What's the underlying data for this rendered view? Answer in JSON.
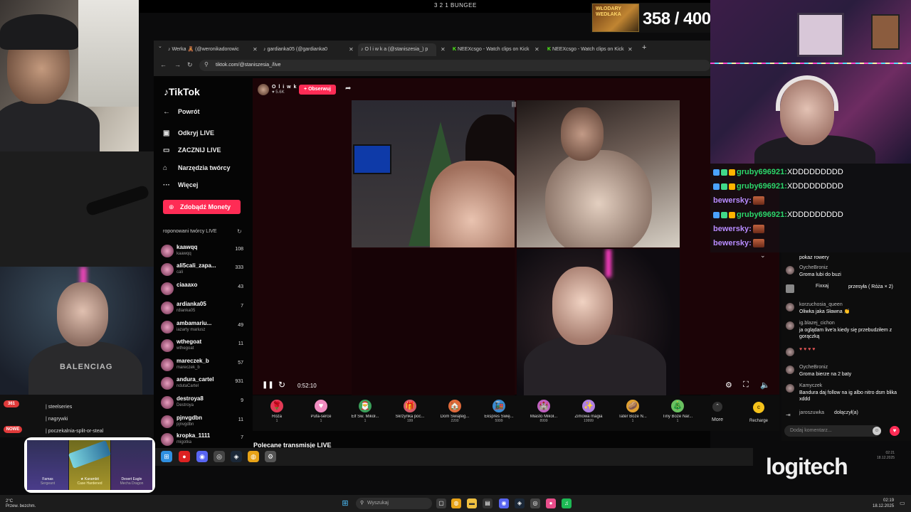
{
  "top_banner": {
    "title": "3 2 1 BUNGEE",
    "counter": "358 / 400",
    "counter_image_text": "WŁODARY WEDŁAKA"
  },
  "browser": {
    "tabs": [
      {
        "label": "Werka 🧸 (@weronikadorowic",
        "active": false
      },
      {
        "label": "gardianka05 (@gardianka0",
        "active": false
      },
      {
        "label": "O l i w k a (@staniszesia_) p",
        "active": true
      },
      {
        "label": "NEEXcsgo - Watch clips on Kick",
        "active": false
      },
      {
        "label": "NEEXcsgo - Watch clips on Kick",
        "active": false
      }
    ],
    "url": "tiktok.com/@staniszesia_/live"
  },
  "tiktok": {
    "logo": "TikTok",
    "nav": [
      "Powrót",
      "Odkryj LIVE",
      "ZACZNIJ LIVE",
      "Narzędzia twórcy",
      "Więcej"
    ],
    "coins_button": "Zdobądź Monety",
    "recommended_title": "roponowani twórcy LIVE",
    "creators": [
      {
        "name": "kaawqq",
        "sub": "kaawqq",
        "count": "108"
      },
      {
        "name": "ali5cali_zapa...",
        "sub": "cali",
        "count": "333"
      },
      {
        "name": "ciaaaxo",
        "sub": "",
        "count": "43"
      },
      {
        "name": "ardianka05",
        "sub": "rdianka05",
        "count": "7"
      },
      {
        "name": "ambamariu...",
        "sub": "iazarty mariusz",
        "count": "49"
      },
      {
        "name": "wthegoat",
        "sub": "wthegoat",
        "count": "11"
      },
      {
        "name": "mareczek_b",
        "sub": "mareczek_b",
        "count": "57"
      },
      {
        "name": "andura_cartel",
        "sub": "ndutaCartel",
        "count": "931"
      },
      {
        "name": "destroya8",
        "sub": "Destroya",
        "count": "9"
      },
      {
        "name": "pjnvgdbn",
        "sub": "pjnvgdbn",
        "count": "11"
      },
      {
        "name": "kropka_1111",
        "sub": "migotka",
        "count": "7"
      }
    ],
    "host": {
      "name": "O l i w k a",
      "likes": "♥ 5.6K",
      "follow": "+ Obserwuj"
    },
    "player": {
      "time": "0:52:10"
    },
    "gifts": [
      {
        "name": "Róża",
        "price": "1",
        "color": "#e23a55",
        "icon": "🌹"
      },
      {
        "name": "Pufa-serce",
        "price": "1",
        "color": "#f08cc0",
        "icon": "♥"
      },
      {
        "name": "Elf Św. Mikoł...",
        "price": "1",
        "color": "#3aa05a",
        "icon": "🎅"
      },
      {
        "name": "Skrzynka poc...",
        "price": "199",
        "color": "#d85a6a",
        "icon": "🎁"
      },
      {
        "name": "Dom Świąteg...",
        "price": "2200",
        "color": "#e06a3a",
        "icon": "🏠"
      },
      {
        "name": "Ekspres Świę...",
        "price": "5999",
        "color": "#3a8ad0",
        "icon": "🚂"
      },
      {
        "name": "Miasto Mikoł...",
        "price": "8999",
        "color": "#c060c0",
        "icon": "🏰"
      },
      {
        "name": "Zimowa magia",
        "price": "19999",
        "color": "#b080e0",
        "icon": "✨"
      },
      {
        "name": "Tater Boże N...",
        "price": "1",
        "color": "#e0a030",
        "icon": "🥔"
      },
      {
        "name": "Tiny Boże Nar...",
        "price": "1",
        "color": "#6ac060",
        "icon": "🎄"
      }
    ],
    "more": "More",
    "recharge": "Recharge",
    "recommended_live": "Polecane transmisje LIVE",
    "comment_placeholder": "Dodaj komentarz...",
    "chat": [
      {
        "user": "",
        "msg": "pokaz rowery"
      },
      {
        "user": "OycheBroniz",
        "msg": "Groma lubi do buzi"
      },
      {
        "user": "Fixxaj",
        "msg": "przesyła ( Róża × 2)"
      },
      {
        "user": "korzuchosia_queen",
        "msg": "Oliwka jaka Sławna 👏"
      },
      {
        "user": "ig.blazej_cichon",
        "msg": "ja oglądam live'a kiedy się przebudziłem z gorączką"
      },
      {
        "user": "",
        "msg": ""
      },
      {
        "user": "OycheBroniz",
        "msg": "Groma bierze na 2 baty"
      },
      {
        "user": "Kamyczek",
        "msg": "Bandura daj follow na ig albo nitro dsm blika xddd"
      },
      {
        "user": "jaroszuwka",
        "msg": "dołączył(a)"
      }
    ]
  },
  "overlay_chat": [
    {
      "user": "gruby696921:",
      "msg": "XDDDDDDDDD",
      "style": "green"
    },
    {
      "user": "gruby696921:",
      "msg": "XDDDDDDDDD",
      "style": "green"
    },
    {
      "user": "bewersky:",
      "msg": "",
      "style": "purple"
    },
    {
      "user": "gruby696921:",
      "msg": "XDDDDDDDDD",
      "style": "green"
    },
    {
      "user": "bewersky:",
      "msg": "",
      "style": "purple"
    },
    {
      "user": "bewersky:",
      "msg": "",
      "style": "purple"
    }
  ],
  "obs_list": [
    {
      "badge": "361",
      "label": ""
    },
    {
      "badge": "",
      "label": "| steelseries"
    },
    {
      "badge": "",
      "label": "| nagrywki"
    },
    {
      "badge": "NOWE",
      "label": "| poczekalnia-split-or-steal"
    }
  ],
  "skin_cards": [
    {
      "name": "Famas",
      "sub": "Sergeant"
    },
    {
      "name": "★ Karambit",
      "sub": "Case Hardened"
    },
    {
      "name": "Desert Eagle",
      "sub": "Mecha Dragon"
    }
  ],
  "brand": "logitech",
  "os": {
    "weather": "2°C",
    "weather_sub": "Przew. bezchm.",
    "search_placeholder": "Wyszukaj",
    "time": "02:19",
    "date": "18.12.2025",
    "inner_time": "02:21",
    "inner_date": "18.12.2025"
  },
  "colors": {
    "tiktok_red": "#fe2c55",
    "chat_green": "#2bd66a",
    "chat_purple": "#b88cff"
  }
}
